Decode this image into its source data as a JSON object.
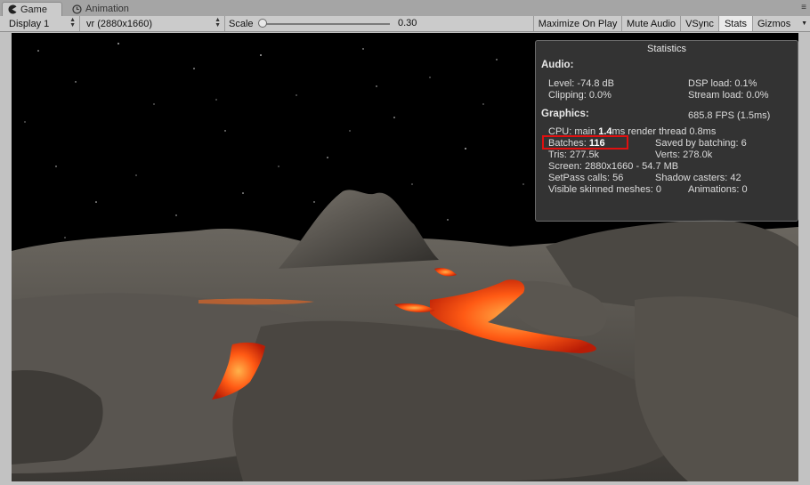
{
  "tabs": [
    {
      "label": "Game",
      "icon": "pacman-icon",
      "active": true
    },
    {
      "label": "Animation",
      "icon": "clock-icon",
      "active": false
    }
  ],
  "toolbar": {
    "display": "Display 1",
    "resolution": "vr (2880x1660)",
    "scale_label": "Scale",
    "scale_value": "0.30",
    "scale_fraction": 0.01,
    "buttons": [
      {
        "label": "Maximize On Play",
        "on": false
      },
      {
        "label": "Mute Audio",
        "on": false
      },
      {
        "label": "VSync",
        "on": false
      },
      {
        "label": "Stats",
        "on": true
      },
      {
        "label": "Gizmos",
        "dropdown": true
      }
    ]
  },
  "stats": {
    "title": "Statistics",
    "audio_header": "Audio:",
    "level": "Level: -74.8 dB",
    "dsp_load": "DSP load: 0.1%",
    "clipping": "Clipping: 0.0%",
    "stream_load": "Stream load: 0.0%",
    "graphics_header": "Graphics:",
    "fps": "685.8 FPS (1.5ms)",
    "cpu_prefix": "CPU: main ",
    "cpu_main": "1.4",
    "cpu_suffix": "ms  render thread 0.8ms",
    "batches_label": "Batches: ",
    "batches_value": "116",
    "saved_by_batching": "Saved by batching: 6",
    "tris": "Tris: 277.5k",
    "verts": "Verts: 278.0k",
    "screen": "Screen: 2880x1660 - 54.7 MB",
    "setpass": "SetPass calls: 56",
    "shadow_casters": "Shadow casters: 42",
    "skinned": "Visible skinned meshes: 0",
    "animations": "Animations: 0",
    "highlight_color": "#e01010"
  },
  "colors": {
    "lava": "#ff4a10",
    "rock": "#5f5b55",
    "sky": "#000000"
  }
}
